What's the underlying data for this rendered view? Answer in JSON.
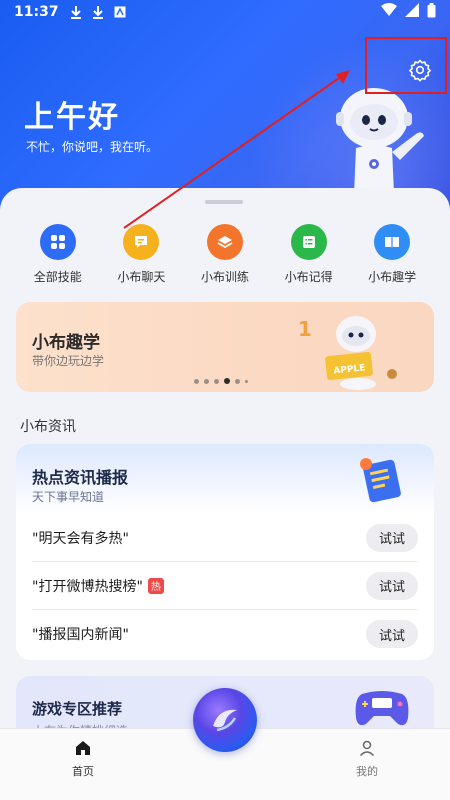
{
  "status_bar": {
    "time": "11:37"
  },
  "header": {
    "greeting": "上午好",
    "subtitle": "不忙，你说吧，我在听。"
  },
  "quick_actions": [
    {
      "label": "全部技能",
      "color": "#2f6cf5",
      "icon": "grid-icon"
    },
    {
      "label": "小布聊天",
      "color": "#f5b21e",
      "icon": "chat-icon"
    },
    {
      "label": "小布训练",
      "color": "#f3742b",
      "icon": "layers-icon"
    },
    {
      "label": "小布记得",
      "color": "#2bb84a",
      "icon": "list-icon"
    },
    {
      "label": "小布趣学",
      "color": "#2f8ef5",
      "icon": "book-icon"
    }
  ],
  "banner": {
    "title": "小布趣学",
    "subtitle": "带你边玩边学",
    "art_text": "APPLE"
  },
  "news_section": {
    "title": "小布资讯",
    "card_title": "热点资讯播报",
    "card_subtitle": "天下事早知道",
    "items": [
      {
        "text": "\"明天会有多热\"",
        "hot": false,
        "button": "试试"
      },
      {
        "text": "\"打开微博热搜榜\"",
        "hot": true,
        "hot_label": "热",
        "button": "试试"
      },
      {
        "text": "\"播报国内新闻\"",
        "hot": false,
        "button": "试试"
      }
    ]
  },
  "game_section": {
    "title": "游戏专区推荐",
    "subtitle": "小布为你精挑细选"
  },
  "tabbar": {
    "home": "首页",
    "mine": "我的"
  },
  "colors": {
    "accent": "#2f6cff",
    "highlight": "#e02020"
  }
}
